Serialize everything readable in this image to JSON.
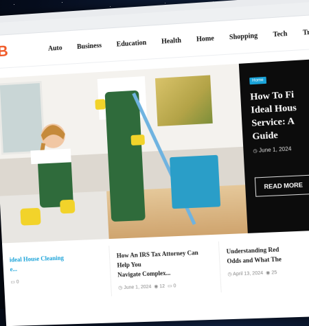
{
  "logo": {
    "text": "B",
    "color": "#f05a28"
  },
  "nav": [
    "Auto",
    "Business",
    "Education",
    "Health",
    "Home",
    "Shopping",
    "Tech",
    "Trave"
  ],
  "hero": {
    "feature": {
      "tag": "Home",
      "title": "How To Fi\nIdeal Hous\nService: A\nGuide",
      "date": "June 1, 2024",
      "read_more": "READ MORE"
    }
  },
  "posts": [
    {
      "title": "ideal House Cleaning\ne...",
      "views": "",
      "comments": "0",
      "date": "",
      "highlight": true
    },
    {
      "title": "How An IRS Tax Attorney Can Help You\nNavigate Complex...",
      "date": "June 1, 2024",
      "views": "12",
      "comments": "0",
      "highlight": false
    },
    {
      "title": "Understanding Red\nOdds and What The",
      "date": "April 13, 2024",
      "views": "25",
      "comments": "",
      "highlight": false
    }
  ],
  "icons": {
    "calendar": "calendar-icon",
    "eye": "eye-icon",
    "comment": "comment-icon"
  },
  "colors": {
    "accent": "#1aa3d9",
    "brand": "#f05a28",
    "feature_bg": "#0c0c0c"
  }
}
